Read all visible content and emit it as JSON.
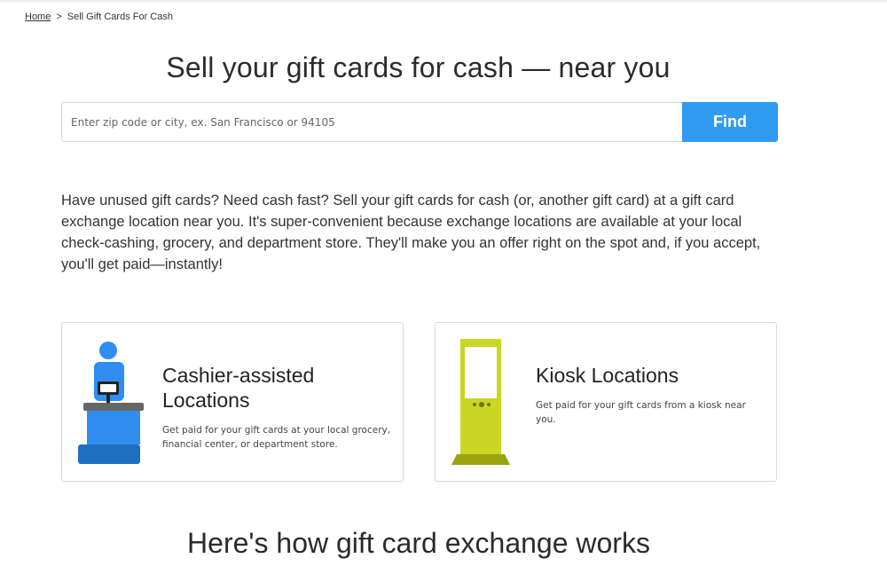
{
  "breadcrumb": {
    "home": "Home",
    "separator": ">",
    "current": "Sell Gift Cards For Cash"
  },
  "hero": {
    "title": "Sell your gift cards for cash — near you"
  },
  "search": {
    "placeholder": "Enter zip code or city, ex. San Francisco or 94105",
    "value": "",
    "button_label": "Find"
  },
  "intro": {
    "text": "Have unused gift cards? Need cash fast? Sell your gift cards for cash (or, another gift card) at a gift card exchange location near you. It's super-convenient because exchange locations are available at your local check-cashing, grocery, and department store. They'll make you an offer right on the spot and, if you accept, you'll get paid—instantly!"
  },
  "cards": [
    {
      "title": "Cashier-assisted Locations",
      "description": "Get paid for your gift cards at your local grocery, financial center, or department store.",
      "icon": "cashier-icon"
    },
    {
      "title": "Kiosk Locations",
      "description": "Get paid for your gift cards from a kiosk near you.",
      "icon": "kiosk-icon"
    }
  ],
  "how_it_works": {
    "title": "Here's how gift card exchange works"
  },
  "colors": {
    "accent": "#2f9bf2",
    "cashier_blue": "#2f8ef0",
    "cashier_dark": "#1f6fc0",
    "kiosk_green": "#c9d623",
    "kiosk_dark": "#9aa30f"
  }
}
